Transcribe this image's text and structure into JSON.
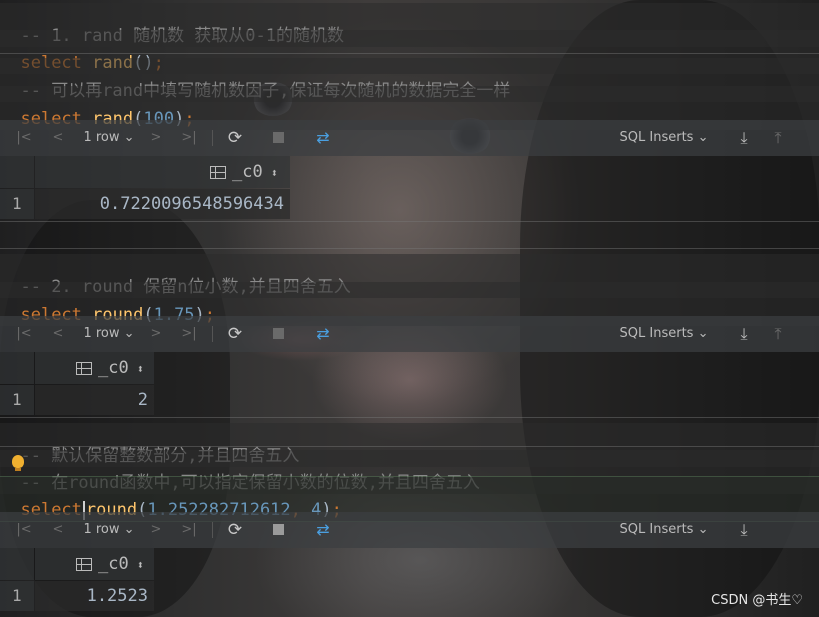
{
  "editor": {
    "line1": {
      "comment": "-- 1. rand 随机数 获取从0-1的随机数"
    },
    "line2": {
      "kw": "select",
      "fn": "rand",
      "open": "(",
      "close": ")",
      "semi": ";"
    },
    "line3": {
      "comment": "-- 可以再rand中填写随机数因子,保证每次随机的数据完全一样"
    },
    "line4": {
      "kw": "select",
      "fn": "rand",
      "open": "(",
      "arg": "100",
      "close": ")",
      "semi": ";"
    },
    "line5": {
      "comment": "-- 2. round 保留n位小数,并且四舍五入"
    },
    "line6": {
      "kw": "select",
      "fn": "round",
      "open": "(",
      "arg": "1.75",
      "close": ")",
      "semi": ";"
    },
    "line7": {
      "comment": "-- 默认保留整数部分,并且四舍五入"
    },
    "line8": {
      "comment": "-- 在round函数中,可以指定保留小数的位数,并且四舍五入"
    },
    "line9": {
      "kw_a": "selec",
      "kw_b": "t",
      "fn": "round",
      "open": "(",
      "arg1": "1.252282712612",
      "comma": ",",
      "arg2": "4",
      "close": ")",
      "semi": ";"
    }
  },
  "toolbar": {
    "first_icon": "first-page-icon",
    "prev_icon": "prev-page-icon",
    "rows_label": "1 row",
    "next_icon": "next-page-icon",
    "last_icon": "last-page-icon",
    "reload_icon": "reload-icon",
    "stop_icon": "stop-icon",
    "compare_icon": "compare-icon",
    "format_label": "SQL Inserts",
    "download_icon": "download-icon",
    "upload_icon": "upload-icon",
    "glyph_first": "|<",
    "glyph_prev": "<",
    "glyph_chevron": "⌄",
    "glyph_next": ">",
    "glyph_last": ">|",
    "glyph_reload": "⟳",
    "glyph_compare": "⇄",
    "glyph_download": "⤓",
    "glyph_upload": "⤒"
  },
  "results": [
    {
      "column": "_c0",
      "row_number": "1",
      "value": "0.7220096548596434"
    },
    {
      "column": "_c0",
      "row_number": "1",
      "value": "2"
    },
    {
      "column": "_c0",
      "row_number": "1",
      "value": "1.2523"
    }
  ],
  "sort_glyph": "⬍",
  "watermark": "CSDN @书生♡",
  "colors": {
    "keyword": "#cc7832",
    "function": "#ffc66d",
    "number": "#6897bb",
    "comment": "#8a8a8a",
    "accent": "#4a9fe0"
  }
}
